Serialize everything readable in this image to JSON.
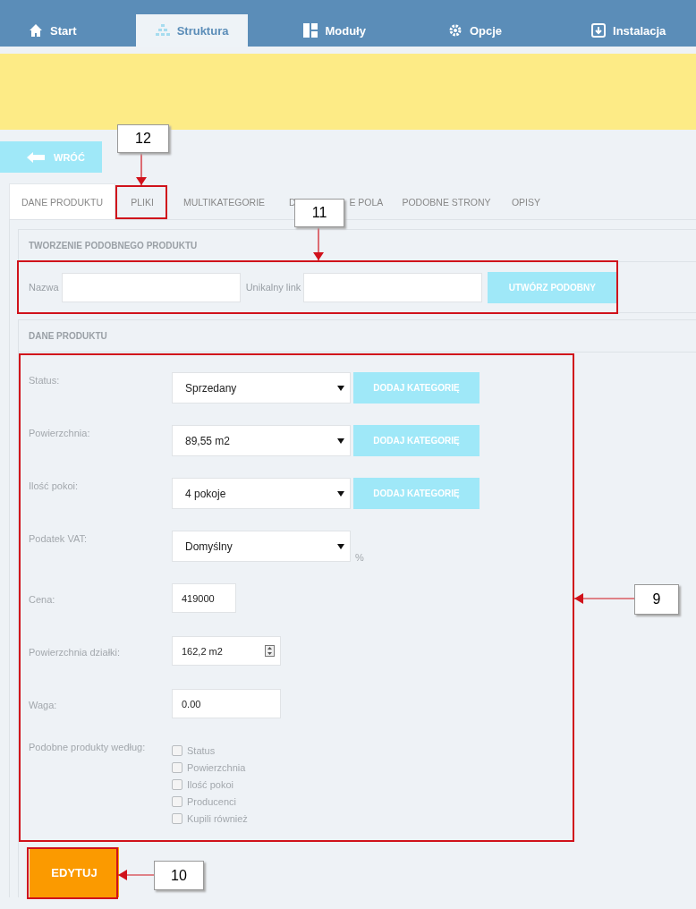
{
  "nav": [
    {
      "label": "Start",
      "selected": false
    },
    {
      "label": "Struktura",
      "selected": true
    },
    {
      "label": "Moduły",
      "selected": false
    },
    {
      "label": "Opcje",
      "selected": false
    },
    {
      "label": "Instalacja",
      "selected": false
    }
  ],
  "back_button": "WRÓĆ",
  "tabs": [
    {
      "label_parts": [
        "DANE PRODUKTU"
      ],
      "selected": true
    },
    {
      "label_parts": [
        "PLIKI"
      ],
      "selected": false
    },
    {
      "label_parts": [
        "MULTIKATEGORIE"
      ],
      "selected": false
    },
    {
      "label_parts": [
        "D",
        "E POLA"
      ],
      "selected": false
    },
    {
      "label_parts": [
        "PODOBNE STRONY"
      ],
      "selected": false
    },
    {
      "label_parts": [
        "OPISY"
      ],
      "selected": false
    }
  ],
  "similar_panel": {
    "title": "TWORZENIE PODOBNEGO PRODUKTU",
    "fields": [
      {
        "label": "Nazwa"
      },
      {
        "label": "Unikalny link"
      }
    ],
    "button": "UTWÓRZ PODOBNY"
  },
  "product_panel": {
    "title": "DANE PRODUKTU",
    "rows": [
      {
        "kind": "select",
        "label": "Status:",
        "value": "Sprzedany",
        "button": "DODAJ KATEGORIĘ"
      },
      {
        "kind": "select",
        "label": "Powierzchnia:",
        "value": "89,55 m2",
        "button": "DODAJ KATEGORIĘ"
      },
      {
        "kind": "select",
        "label": "Ilość pokoi:",
        "value": "4 pokoje",
        "button": "DODAJ KATEGORIĘ"
      },
      {
        "kind": "select",
        "label": "Podatek VAT:",
        "value": "Domyślny",
        "unit": "%"
      },
      {
        "kind": "short_text",
        "label": "Cena:",
        "value": "419000"
      },
      {
        "kind": "spinner",
        "label": "Powierzchnia działki:",
        "value": "162,2 m2"
      },
      {
        "kind": "text",
        "label": "Waga:",
        "value": "0.00"
      },
      {
        "kind": "checks",
        "label": "Podobne produkty według:",
        "options": [
          {
            "label": "Status",
            "checked": false
          },
          {
            "label": "Powierzchnia",
            "checked": false
          },
          {
            "label": "Ilość pokoi",
            "checked": false
          },
          {
            "label": "Producenci",
            "checked": false
          },
          {
            "label": "Kupili również",
            "checked": false
          }
        ]
      }
    ]
  },
  "submit_button": "EDYTUJ",
  "annotations": [
    {
      "number": "12"
    },
    {
      "number": "11"
    },
    {
      "number": "9"
    },
    {
      "number": "10"
    }
  ]
}
